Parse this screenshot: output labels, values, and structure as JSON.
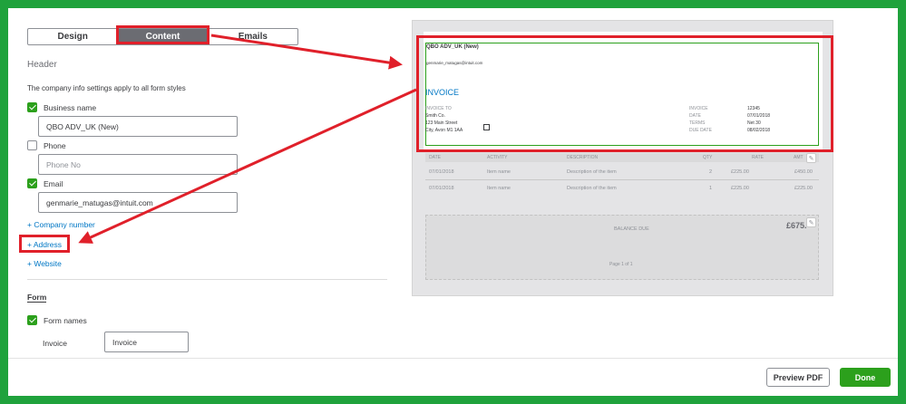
{
  "tabs": [
    {
      "label": "Design",
      "active": false
    },
    {
      "label": "Content",
      "active": true
    },
    {
      "label": "Emails",
      "active": false
    }
  ],
  "settings": {
    "header_label": "Header",
    "company_note": "The company info settings apply to all form styles",
    "business_name": {
      "label": "Business name",
      "checked": true,
      "value": "QBO ADV_UK (New)"
    },
    "phone": {
      "label": "Phone",
      "checked": false,
      "placeholder": "Phone No"
    },
    "email": {
      "label": "Email",
      "checked": true,
      "value": "genmarie_matugas@intuit.com"
    },
    "links": {
      "company_number": "+ Company number",
      "address": "+ Address",
      "website": "+ Website"
    },
    "form_label": "Form",
    "form_names": {
      "label": "Form names",
      "checked": true
    },
    "invoice_label": "Invoice",
    "invoice_value": "Invoice"
  },
  "preview": {
    "company": "QBO ADV_UK (New)",
    "email": "genmarie_matugas@intuit.com",
    "doc_title": "INVOICE",
    "invoice_to_label": "INVOICE TO",
    "address_lines": [
      "Smith Co.",
      "123 Main Street",
      "City, Avon M1 1AA"
    ],
    "meta": [
      {
        "label": "INVOICE",
        "value": "12345"
      },
      {
        "label": "DATE",
        "value": "07/01/2018"
      },
      {
        "label": "TERMS",
        "value": "Net 30"
      },
      {
        "label": "DUE DATE",
        "value": "08/02/2018"
      }
    ],
    "columns": [
      "DATE",
      "ACTIVITY",
      "DESCRIPTION",
      "QTY",
      "RATE",
      "AMT"
    ],
    "rows": [
      {
        "date": "07/01/2018",
        "activity": "Item name",
        "description": "Description of the item",
        "qty": "2",
        "rate": "£225.00",
        "amount": "£450.00"
      },
      {
        "date": "07/01/2018",
        "activity": "Item name",
        "description": "Description of the item",
        "qty": "1",
        "rate": "£225.00",
        "amount": "£225.00"
      }
    ],
    "balance_due_label": "BALANCE DUE",
    "balance_due_value": "£675.",
    "page_label": "Page 1 of 1"
  },
  "footer": {
    "preview_pdf": "Preview PDF",
    "done": "Done"
  },
  "colors": {
    "accent_green": "#2ca01c",
    "annotation_red": "#e0202a",
    "frame_green": "#1fa23c",
    "link_blue": "#0077c5"
  }
}
